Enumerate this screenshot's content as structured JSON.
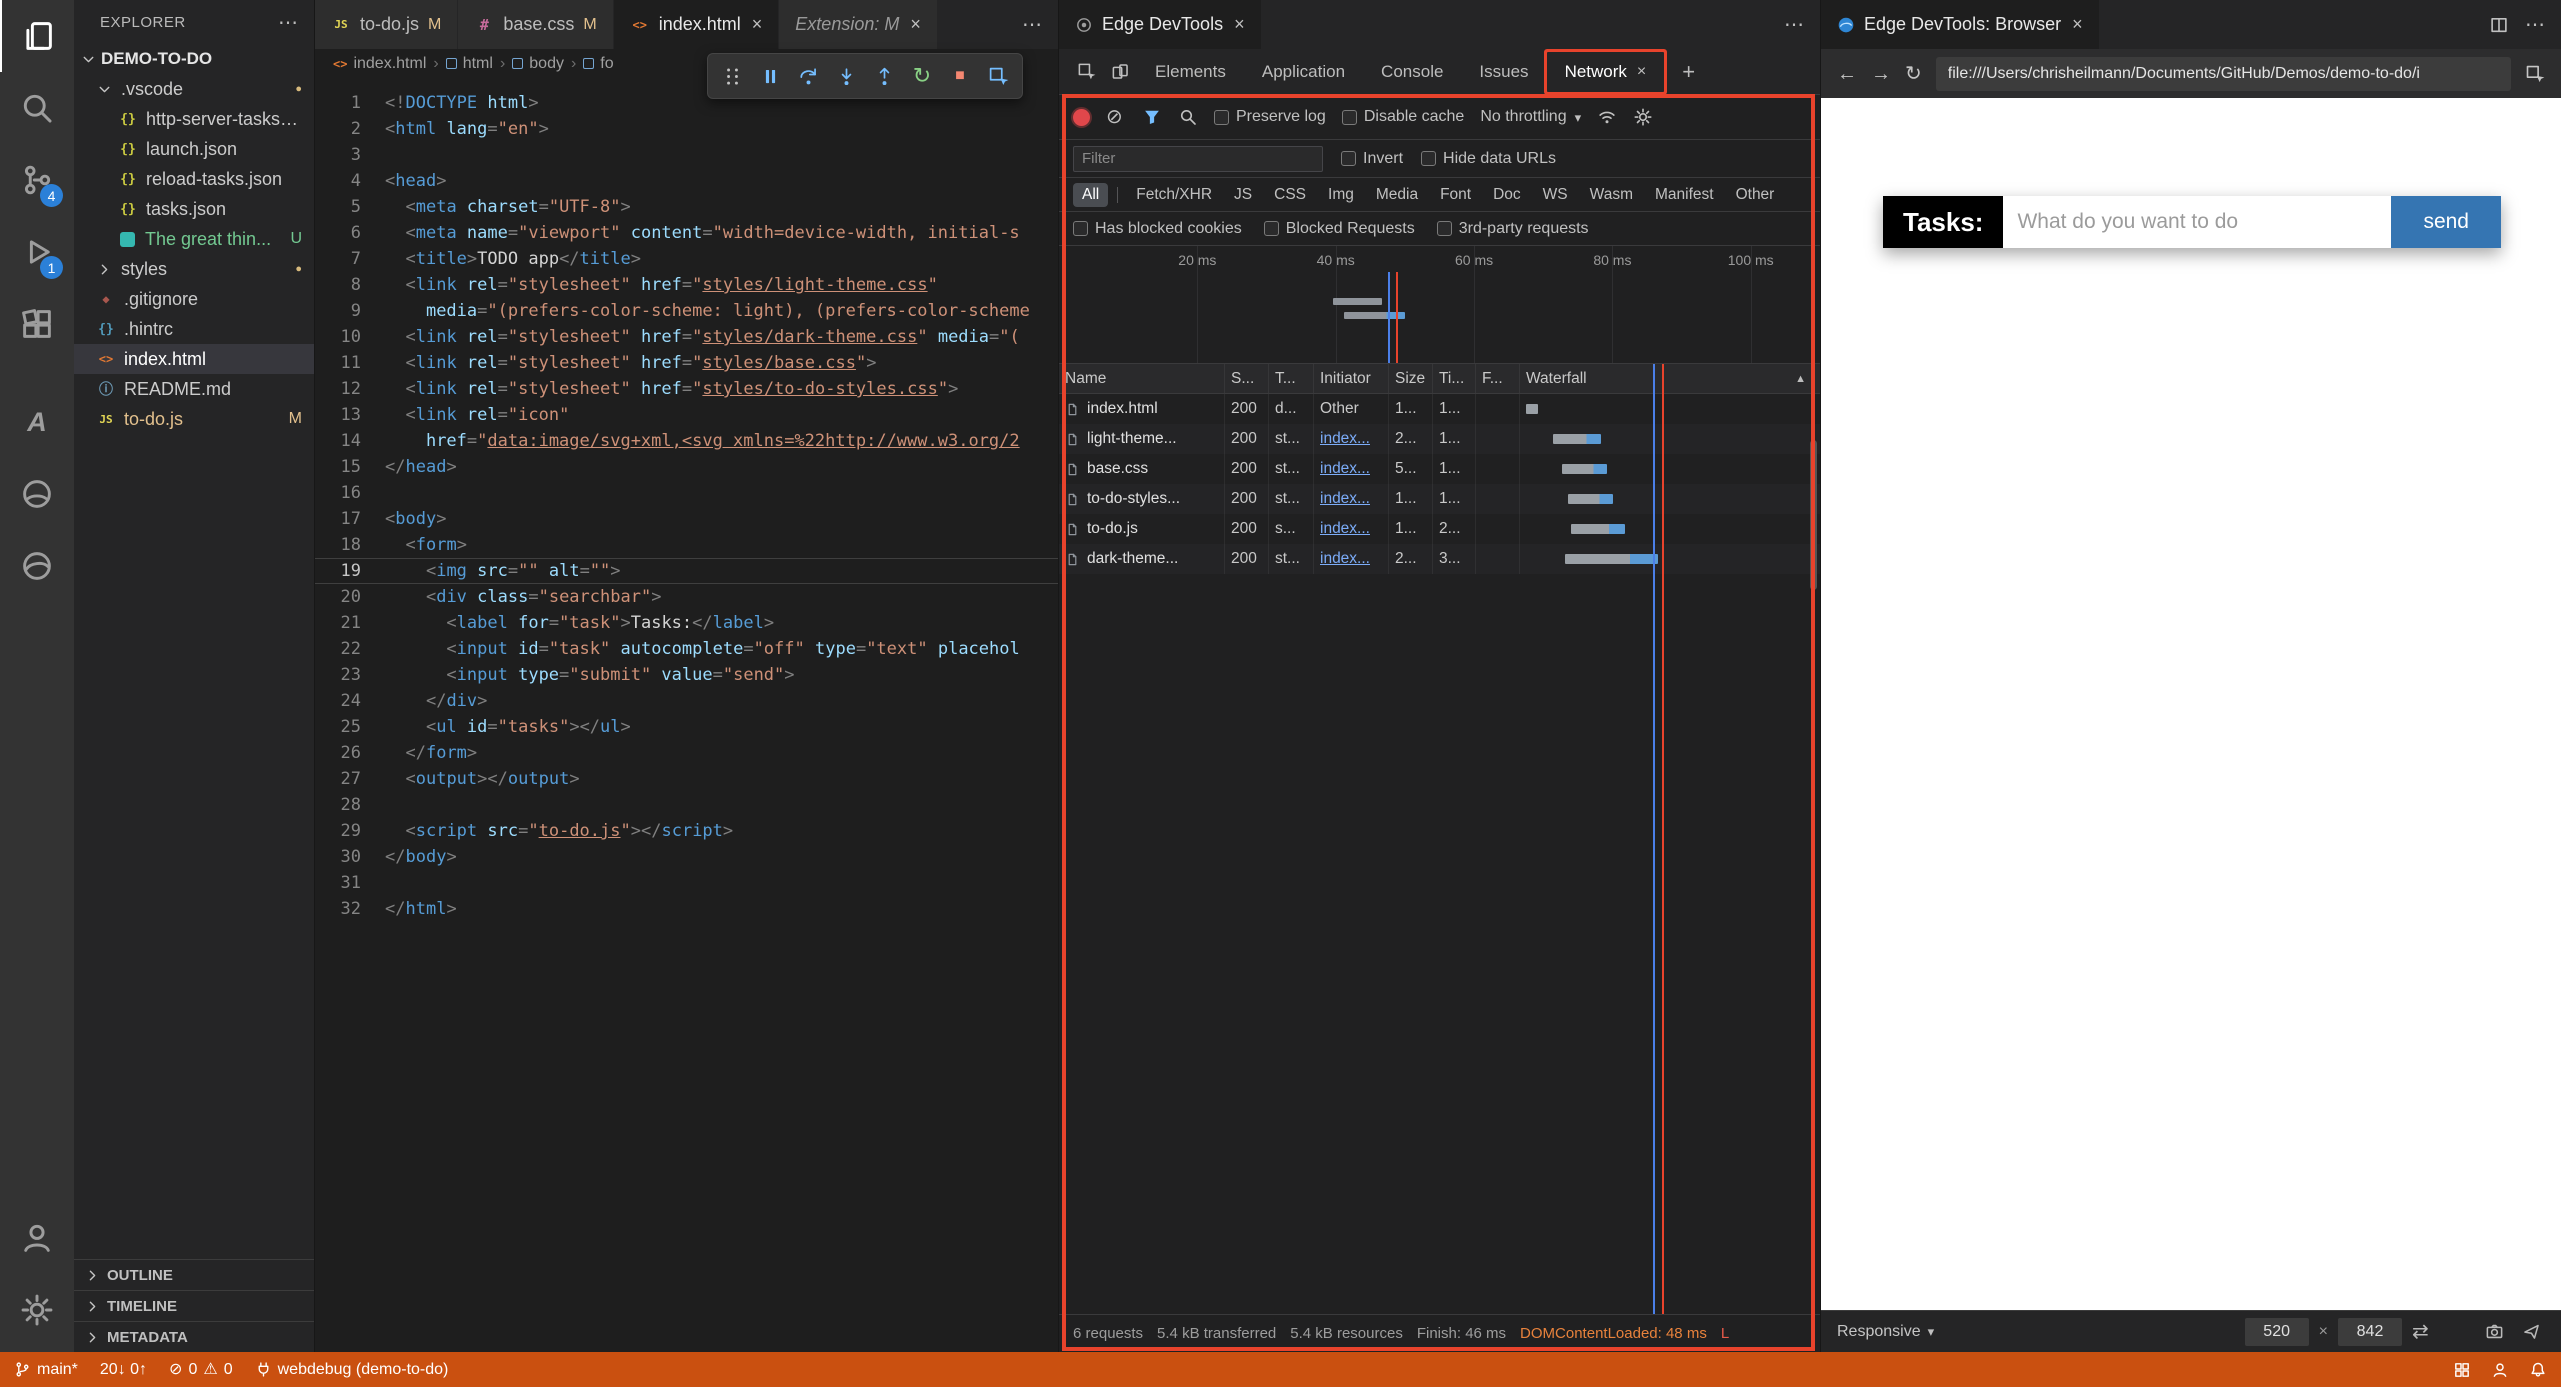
{
  "ui": {
    "close": "×",
    "more": "⋯",
    "plus": "+",
    "sort": "▲",
    "sep": "›"
  },
  "activity_bar": {
    "icons": [
      {
        "name": "files",
        "active": true
      },
      {
        "name": "search"
      },
      {
        "name": "source-control",
        "badge": "4"
      },
      {
        "name": "run-debug",
        "badge": "1"
      },
      {
        "name": "extensions"
      },
      {
        "name": "azure",
        "gap": true
      },
      {
        "name": "remote"
      },
      {
        "name": "edge-devtools"
      }
    ],
    "bottom": [
      {
        "name": "account"
      },
      {
        "name": "settings-gear"
      }
    ]
  },
  "explorer": {
    "title": "EXPLORER",
    "root_label": "DEMO-TO-DO",
    "items": [
      {
        "kind": "folder",
        "label": ".vscode",
        "depth": 1,
        "expanded": true,
        "dot": true
      },
      {
        "kind": "file",
        "icon": "json",
        "label": "http-server-tasks.j...",
        "depth": 2
      },
      {
        "kind": "file",
        "icon": "json",
        "label": "launch.json",
        "depth": 2
      },
      {
        "kind": "file",
        "icon": "json",
        "label": "reload-tasks.json",
        "depth": 2
      },
      {
        "kind": "file",
        "icon": "json",
        "label": "tasks.json",
        "depth": 2
      },
      {
        "kind": "file",
        "icon": "teal",
        "label": "The great thin...",
        "depth": 2,
        "badge": "U",
        "badge_color": "#73c991",
        "label_color": "#73c991"
      },
      {
        "kind": "folder",
        "label": "styles",
        "depth": 1,
        "expanded": false,
        "dot": true
      },
      {
        "kind": "file",
        "icon": "git",
        "label": ".gitignore",
        "depth": 1
      },
      {
        "kind": "file",
        "icon": "json-gray",
        "label": ".hintrc",
        "depth": 1
      },
      {
        "kind": "file",
        "icon": "html",
        "label": "index.html",
        "depth": 1,
        "selected": true
      },
      {
        "kind": "file",
        "icon": "markdown",
        "label": "README.md",
        "depth": 1
      },
      {
        "kind": "file",
        "icon": "js",
        "label": "to-do.js",
        "depth": 1,
        "badge": "M",
        "badge_color": "#e2c08d",
        "label_color": "#e2c08d"
      }
    ],
    "sections": [
      "OUTLINE",
      "TIMELINE",
      "METADATA"
    ]
  },
  "editor": {
    "tabs": [
      {
        "icon": "js",
        "label": "to-do.js",
        "badge": "M"
      },
      {
        "icon": "css",
        "label": "base.css",
        "badge": "M"
      },
      {
        "icon": "html",
        "label": "index.html",
        "close": true,
        "active": true
      },
      {
        "icon": null,
        "label": "Extension: M",
        "close": true,
        "italic": true
      }
    ],
    "breadcrumb": [
      {
        "icon": "html",
        "label": "index.html"
      },
      {
        "icon": "box",
        "label": "html"
      },
      {
        "icon": "box",
        "label": "body"
      },
      {
        "icon": "box",
        "label": "fo"
      }
    ],
    "active_line": 19,
    "lines": [
      [
        [
          "p",
          "<!"
        ],
        [
          "t",
          "DOCTYPE"
        ],
        [
          "a",
          " html"
        ],
        [
          "p",
          ">"
        ]
      ],
      [
        [
          "p",
          "<"
        ],
        [
          "t",
          "html"
        ],
        [
          "a",
          " lang"
        ],
        [
          "p",
          "="
        ],
        [
          "s",
          "\"en\""
        ],
        [
          "p",
          ">"
        ]
      ],
      [],
      [
        [
          "p",
          "<"
        ],
        [
          "t",
          "head"
        ],
        [
          "p",
          ">"
        ]
      ],
      [
        [
          "x",
          "  "
        ],
        [
          "p",
          "<"
        ],
        [
          "t",
          "meta"
        ],
        [
          "a",
          " charset"
        ],
        [
          "p",
          "="
        ],
        [
          "s",
          "\"UTF-8\""
        ],
        [
          "p",
          ">"
        ]
      ],
      [
        [
          "x",
          "  "
        ],
        [
          "p",
          "<"
        ],
        [
          "t",
          "meta"
        ],
        [
          "a",
          " name"
        ],
        [
          "p",
          "="
        ],
        [
          "s",
          "\"viewport\""
        ],
        [
          "a",
          " content"
        ],
        [
          "p",
          "="
        ],
        [
          "s",
          "\"width=device-width, initial-s"
        ]
      ],
      [
        [
          "x",
          "  "
        ],
        [
          "p",
          "<"
        ],
        [
          "t",
          "title"
        ],
        [
          "p",
          ">"
        ],
        [
          "x",
          "TODO app"
        ],
        [
          "p",
          "</"
        ],
        [
          "t",
          "title"
        ],
        [
          "p",
          ">"
        ]
      ],
      [
        [
          "x",
          "  "
        ],
        [
          "p",
          "<"
        ],
        [
          "t",
          "link"
        ],
        [
          "a",
          " rel"
        ],
        [
          "p",
          "="
        ],
        [
          "s",
          "\"stylesheet\""
        ],
        [
          "a",
          " href"
        ],
        [
          "p",
          "="
        ],
        [
          "s",
          "\""
        ],
        [
          "u",
          "styles/light-theme.css"
        ],
        [
          "s",
          "\""
        ]
      ],
      [
        [
          "x",
          "    "
        ],
        [
          "a",
          "media"
        ],
        [
          "p",
          "="
        ],
        [
          "s",
          "\"(prefers-color-scheme: light), (prefers-color-scheme"
        ]
      ],
      [
        [
          "x",
          "  "
        ],
        [
          "p",
          "<"
        ],
        [
          "t",
          "link"
        ],
        [
          "a",
          " rel"
        ],
        [
          "p",
          "="
        ],
        [
          "s",
          "\"stylesheet\""
        ],
        [
          "a",
          " href"
        ],
        [
          "p",
          "="
        ],
        [
          "s",
          "\""
        ],
        [
          "u",
          "styles/dark-theme.css"
        ],
        [
          "s",
          "\""
        ],
        [
          "a",
          " media"
        ],
        [
          "p",
          "="
        ],
        [
          "s",
          "\"("
        ]
      ],
      [
        [
          "x",
          "  "
        ],
        [
          "p",
          "<"
        ],
        [
          "t",
          "link"
        ],
        [
          "a",
          " rel"
        ],
        [
          "p",
          "="
        ],
        [
          "s",
          "\"stylesheet\""
        ],
        [
          "a",
          " href"
        ],
        [
          "p",
          "="
        ],
        [
          "s",
          "\""
        ],
        [
          "u",
          "styles/base.css"
        ],
        [
          "s",
          "\""
        ],
        [
          "p",
          ">"
        ]
      ],
      [
        [
          "x",
          "  "
        ],
        [
          "p",
          "<"
        ],
        [
          "t",
          "link"
        ],
        [
          "a",
          " rel"
        ],
        [
          "p",
          "="
        ],
        [
          "s",
          "\"stylesheet\""
        ],
        [
          "a",
          " href"
        ],
        [
          "p",
          "="
        ],
        [
          "s",
          "\""
        ],
        [
          "u",
          "styles/to-do-styles.css"
        ],
        [
          "s",
          "\""
        ],
        [
          "p",
          ">"
        ]
      ],
      [
        [
          "x",
          "  "
        ],
        [
          "p",
          "<"
        ],
        [
          "t",
          "link"
        ],
        [
          "a",
          " rel"
        ],
        [
          "p",
          "="
        ],
        [
          "s",
          "\"icon\""
        ]
      ],
      [
        [
          "x",
          "    "
        ],
        [
          "a",
          "href"
        ],
        [
          "p",
          "="
        ],
        [
          "s",
          "\""
        ],
        [
          "u",
          "data:image/svg+xml,<svg xmlns=%22http://www.w3.org/2"
        ]
      ],
      [
        [
          "p",
          "</"
        ],
        [
          "t",
          "head"
        ],
        [
          "p",
          ">"
        ]
      ],
      [],
      [
        [
          "p",
          "<"
        ],
        [
          "t",
          "body"
        ],
        [
          "p",
          ">"
        ]
      ],
      [
        [
          "x",
          "  "
        ],
        [
          "p",
          "<"
        ],
        [
          "t",
          "form"
        ],
        [
          "p",
          ">"
        ]
      ],
      [
        [
          "x",
          "    "
        ],
        [
          "p",
          "<"
        ],
        [
          "t",
          "img"
        ],
        [
          "a",
          " src"
        ],
        [
          "p",
          "="
        ],
        [
          "s",
          "\"\""
        ],
        [
          "a",
          " alt"
        ],
        [
          "p",
          "="
        ],
        [
          "s",
          "\"\""
        ],
        [
          "p",
          ">"
        ]
      ],
      [
        [
          "x",
          "    "
        ],
        [
          "p",
          "<"
        ],
        [
          "t",
          "div"
        ],
        [
          "a",
          " class"
        ],
        [
          "p",
          "="
        ],
        [
          "s",
          "\"searchbar\""
        ],
        [
          "p",
          ">"
        ]
      ],
      [
        [
          "x",
          "      "
        ],
        [
          "p",
          "<"
        ],
        [
          "t",
          "label"
        ],
        [
          "a",
          " for"
        ],
        [
          "p",
          "="
        ],
        [
          "s",
          "\"task\""
        ],
        [
          "p",
          ">"
        ],
        [
          "x",
          "Tasks:"
        ],
        [
          "p",
          "</"
        ],
        [
          "t",
          "label"
        ],
        [
          "p",
          ">"
        ]
      ],
      [
        [
          "x",
          "      "
        ],
        [
          "p",
          "<"
        ],
        [
          "t",
          "input"
        ],
        [
          "a",
          " id"
        ],
        [
          "p",
          "="
        ],
        [
          "s",
          "\"task\""
        ],
        [
          "a",
          " autocomplete"
        ],
        [
          "p",
          "="
        ],
        [
          "s",
          "\"off\""
        ],
        [
          "a",
          " type"
        ],
        [
          "p",
          "="
        ],
        [
          "s",
          "\"text\""
        ],
        [
          "a",
          " placehol"
        ]
      ],
      [
        [
          "x",
          "      "
        ],
        [
          "p",
          "<"
        ],
        [
          "t",
          "input"
        ],
        [
          "a",
          " type"
        ],
        [
          "p",
          "="
        ],
        [
          "s",
          "\"submit\""
        ],
        [
          "a",
          " value"
        ],
        [
          "p",
          "="
        ],
        [
          "s",
          "\"send\""
        ],
        [
          "p",
          ">"
        ]
      ],
      [
        [
          "x",
          "    "
        ],
        [
          "p",
          "</"
        ],
        [
          "t",
          "div"
        ],
        [
          "p",
          ">"
        ]
      ],
      [
        [
          "x",
          "    "
        ],
        [
          "p",
          "<"
        ],
        [
          "t",
          "ul"
        ],
        [
          "a",
          " id"
        ],
        [
          "p",
          "="
        ],
        [
          "s",
          "\"tasks\""
        ],
        [
          "p",
          ">"
        ],
        [
          "p",
          "</"
        ],
        [
          "t",
          "ul"
        ],
        [
          "p",
          ">"
        ]
      ],
      [
        [
          "x",
          "  "
        ],
        [
          "p",
          "</"
        ],
        [
          "t",
          "form"
        ],
        [
          "p",
          ">"
        ]
      ],
      [
        [
          "x",
          "  "
        ],
        [
          "p",
          "<"
        ],
        [
          "t",
          "output"
        ],
        [
          "p",
          ">"
        ],
        [
          "p",
          "</"
        ],
        [
          "t",
          "output"
        ],
        [
          "p",
          ">"
        ]
      ],
      [],
      [
        [
          "x",
          "  "
        ],
        [
          "p",
          "<"
        ],
        [
          "t",
          "script"
        ],
        [
          "a",
          " src"
        ],
        [
          "p",
          "="
        ],
        [
          "s",
          "\""
        ],
        [
          "u",
          "to-do.js"
        ],
        [
          "s",
          "\""
        ],
        [
          "p",
          ">"
        ],
        [
          "p",
          "</"
        ],
        [
          "t",
          "script"
        ],
        [
          "p",
          ">"
        ]
      ],
      [
        [
          "p",
          "</"
        ],
        [
          "t",
          "body"
        ],
        [
          "p",
          ">"
        ]
      ],
      [],
      [
        [
          "p",
          "</"
        ],
        [
          "t",
          "html"
        ],
        [
          "p",
          ">"
        ]
      ]
    ]
  },
  "debug_toolbar": [
    "grip",
    "pause",
    "step-over",
    "step-into",
    "step-out",
    "restart",
    "stop",
    "inspect"
  ],
  "devtools": {
    "tab": {
      "label": "Edge DevTools"
    },
    "tool_tabs": [
      {
        "label": "Elements"
      },
      {
        "label": "Application"
      },
      {
        "label": "Console"
      },
      {
        "label": "Issues"
      },
      {
        "label": "Network",
        "active": true,
        "closable": true
      }
    ],
    "network": {
      "toolbar_checks": [
        "Preserve log",
        "Disable cache"
      ],
      "throttling": "No throttling",
      "filter_placeholder": "Filter",
      "filter_checks": [
        "Invert",
        "Hide data URLs"
      ],
      "type_filters": [
        "All",
        "Fetch/XHR",
        "JS",
        "CSS",
        "Img",
        "Media",
        "Font",
        "Doc",
        "WS",
        "Wasm",
        "Manifest",
        "Other"
      ],
      "active_type": "All",
      "option_checks": [
        "Has blocked cookies",
        "Blocked Requests",
        "3rd-party requests"
      ],
      "ticks": [
        "20 ms",
        "40 ms",
        "60 ms",
        "80 ms",
        "100 ms"
      ],
      "columns": [
        "Name",
        "S...",
        "T...",
        "Initiator",
        "Size",
        "Ti...",
        "F...",
        "Waterfall"
      ],
      "rows": [
        {
          "name": "index.html",
          "status": "200",
          "type": "d...",
          "initiator": "Other",
          "link": false,
          "size": "1...",
          "time": "1...",
          "wf": [
            2,
            4,
            false
          ]
        },
        {
          "name": "light-theme...",
          "status": "200",
          "type": "st...",
          "initiator": "index...",
          "link": true,
          "size": "2...",
          "time": "1...",
          "wf": [
            11,
            16,
            true
          ]
        },
        {
          "name": "base.css",
          "status": "200",
          "type": "st...",
          "initiator": "index...",
          "link": true,
          "size": "5...",
          "time": "1...",
          "wf": [
            14,
            15,
            true
          ]
        },
        {
          "name": "to-do-styles...",
          "status": "200",
          "type": "st...",
          "initiator": "index...",
          "link": true,
          "size": "1...",
          "time": "1...",
          "wf": [
            16,
            15,
            true
          ]
        },
        {
          "name": "to-do.js",
          "status": "200",
          "type": "s...",
          "initiator": "index...",
          "link": true,
          "size": "1...",
          "time": "2...",
          "wf": [
            17,
            18,
            true
          ]
        },
        {
          "name": "dark-theme...",
          "status": "200",
          "type": "st...",
          "initiator": "index...",
          "link": true,
          "size": "2...",
          "time": "3...",
          "wf": [
            15,
            31,
            true
          ]
        }
      ],
      "summary": [
        "6 requests",
        "5.4 kB transferred",
        "5.4 kB resources",
        "Finish: 46 ms"
      ],
      "summary_dcl": "DOMContentLoaded: 48 ms",
      "summary_tail": "L"
    }
  },
  "browser": {
    "tab": {
      "label": "Edge DevTools: Browser"
    },
    "url": "file:///Users/chrisheilmann/Documents/GitHub/Demos/demo-to-do/i",
    "app": {
      "label": "Tasks:",
      "input_placeholder": "What do you want to do",
      "send_label": "send"
    },
    "device_bar": {
      "mode": "Responsive",
      "width": "520",
      "sep": "×",
      "height": "842"
    }
  },
  "status_bar": {
    "branch": "main*",
    "sync": "20↓ 0↑",
    "errors": "0",
    "warnings": "0",
    "remote": "webdebug (demo-to-do)"
  }
}
